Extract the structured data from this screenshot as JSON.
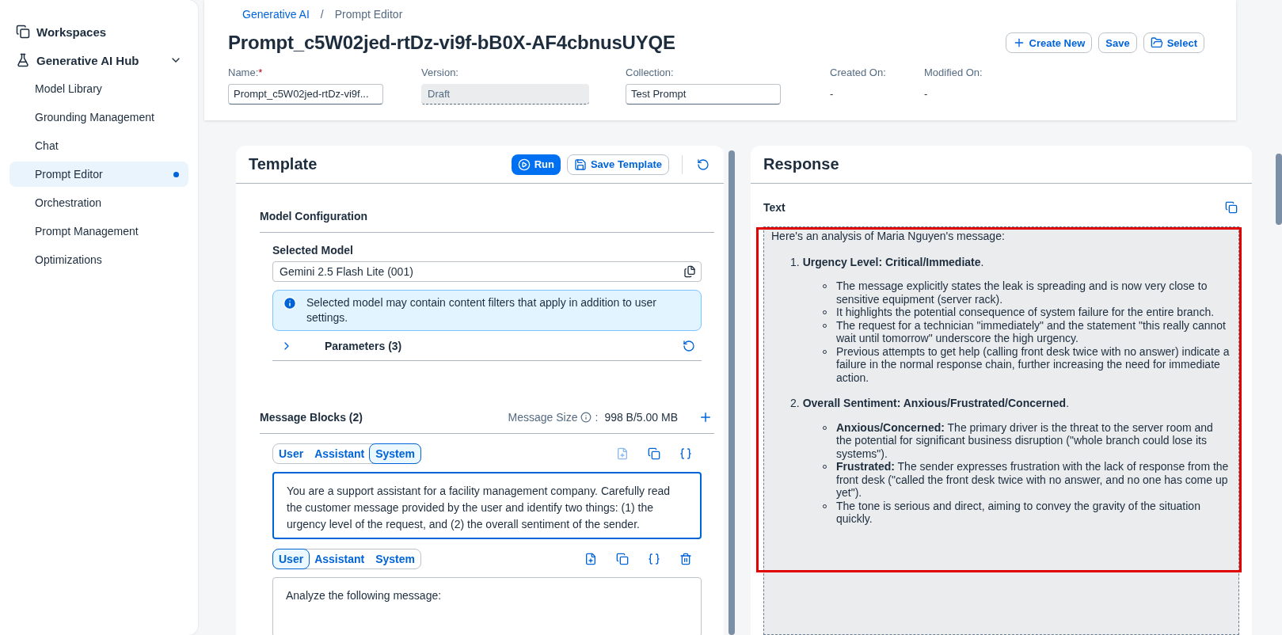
{
  "sidebar": {
    "items": [
      {
        "label": "Workspaces"
      },
      {
        "label": "Generative AI Hub",
        "expanded": true,
        "children": [
          {
            "label": "Model Library",
            "selected": false
          },
          {
            "label": "Grounding Management",
            "selected": false
          },
          {
            "label": "Chat",
            "selected": false
          },
          {
            "label": "Prompt Editor",
            "selected": true
          },
          {
            "label": "Orchestration",
            "selected": false
          },
          {
            "label": "Prompt Management",
            "selected": false
          },
          {
            "label": "Optimizations",
            "selected": false
          }
        ]
      }
    ]
  },
  "header": {
    "breadcrumbs": [
      {
        "label": "Generative AI",
        "kind": "link"
      },
      {
        "label": "/",
        "kind": "separator"
      },
      {
        "label": "Prompt Editor",
        "kind": "current"
      }
    ],
    "title": "Prompt_c5W02jed-rtDz-vi9f-bB0X-AF4cbnusUYQE",
    "actions": [
      {
        "label": "Create New"
      },
      {
        "label": "Save"
      },
      {
        "label": "Select"
      }
    ],
    "fields": [
      {
        "label": "Name:",
        "required_mark": "*",
        "kind": "input",
        "value": "Prompt_c5W02jed-rtDz-vi9f..."
      },
      {
        "label": "Version:",
        "kind": "readonly",
        "value": "Draft"
      },
      {
        "label": "Collection:",
        "kind": "input",
        "value": "Test Prompt"
      },
      {
        "label": "Created On:",
        "kind": "text",
        "value": "-"
      },
      {
        "label": "Modified On:",
        "kind": "text",
        "value": "-"
      }
    ]
  },
  "template": {
    "title": "Template",
    "run_label": "Run",
    "save_label": "Save Template",
    "model_configuration": {
      "heading": "Model Configuration",
      "selected_model_label": "Selected Model",
      "selected_model": "Gemini 2.5 Flash Lite (001)",
      "info": "Selected model may contain content filters that apply in addition to user settings.",
      "parameters": {
        "label": "Parameters (3)",
        "expanded": false
      }
    },
    "message_blocks": {
      "heading": "Message Blocks (2)",
      "size_label": "Message Size",
      "size_separator": ":",
      "size_value": "998 B/5.00 MB",
      "blocks": [
        {
          "roles": [
            {
              "label": "User",
              "selected": false
            },
            {
              "label": "Assistant",
              "selected": false
            },
            {
              "label": "System",
              "selected": true
            }
          ],
          "tools": [
            {
              "kind": "insert",
              "disabled": true
            },
            {
              "kind": "copy",
              "disabled": false
            },
            {
              "kind": "variable",
              "disabled": false
            }
          ],
          "focused": true,
          "text": "You are a support assistant for a facility management company. Carefully read the customer message provided by the user and identify two things: (1) the urgency level of the request, and (2) the overall sentiment of the sender."
        },
        {
          "roles": [
            {
              "label": "User",
              "selected": true
            },
            {
              "label": "Assistant",
              "selected": false
            },
            {
              "label": "System",
              "selected": false
            }
          ],
          "tools": [
            {
              "kind": "insert",
              "disabled": false
            },
            {
              "kind": "copy",
              "disabled": false
            },
            {
              "kind": "variable",
              "disabled": false
            },
            {
              "kind": "delete",
              "disabled": false
            }
          ],
          "focused": false,
          "text": "Analyze the following message:"
        }
      ]
    }
  },
  "response": {
    "title": "Response",
    "text_label": "Text",
    "highlighted": true,
    "intro": "Here's an analysis of Maria Nguyen's message:",
    "sections": [
      {
        "number": "1.",
        "title": "**Urgency Level: Critical/Immediate**.",
        "items": [
          "The message explicitly states the leak is spreading and is now very close to sensitive equipment (server rack).",
          "It highlights the potential consequence of system failure for the entire branch.",
          "The request for a technician \"immediately\" and the statement \"this really cannot wait until tomorrow\" underscore the high urgency.",
          "Previous attempts to get help (calling front desk twice with no answer) indicate a failure in the normal response chain, further increasing the need for immediate action."
        ]
      },
      {
        "number": "2.",
        "title": "**Overall Sentiment: Anxious/Frustrated/Concerned**.",
        "items": [
          "**Anxious/Concerned:** The primary driver is the threat to the server room and the potential for significant business disruption (\"whole branch could lose its systems\").",
          "**Frustrated:** The sender expresses frustration with the lack of response from the front desk (\"called the front desk twice with no answer, and no one has come up yet\").",
          "The tone is serious and direct, aiming to convey the gravity of the situation quickly."
        ]
      }
    ]
  }
}
